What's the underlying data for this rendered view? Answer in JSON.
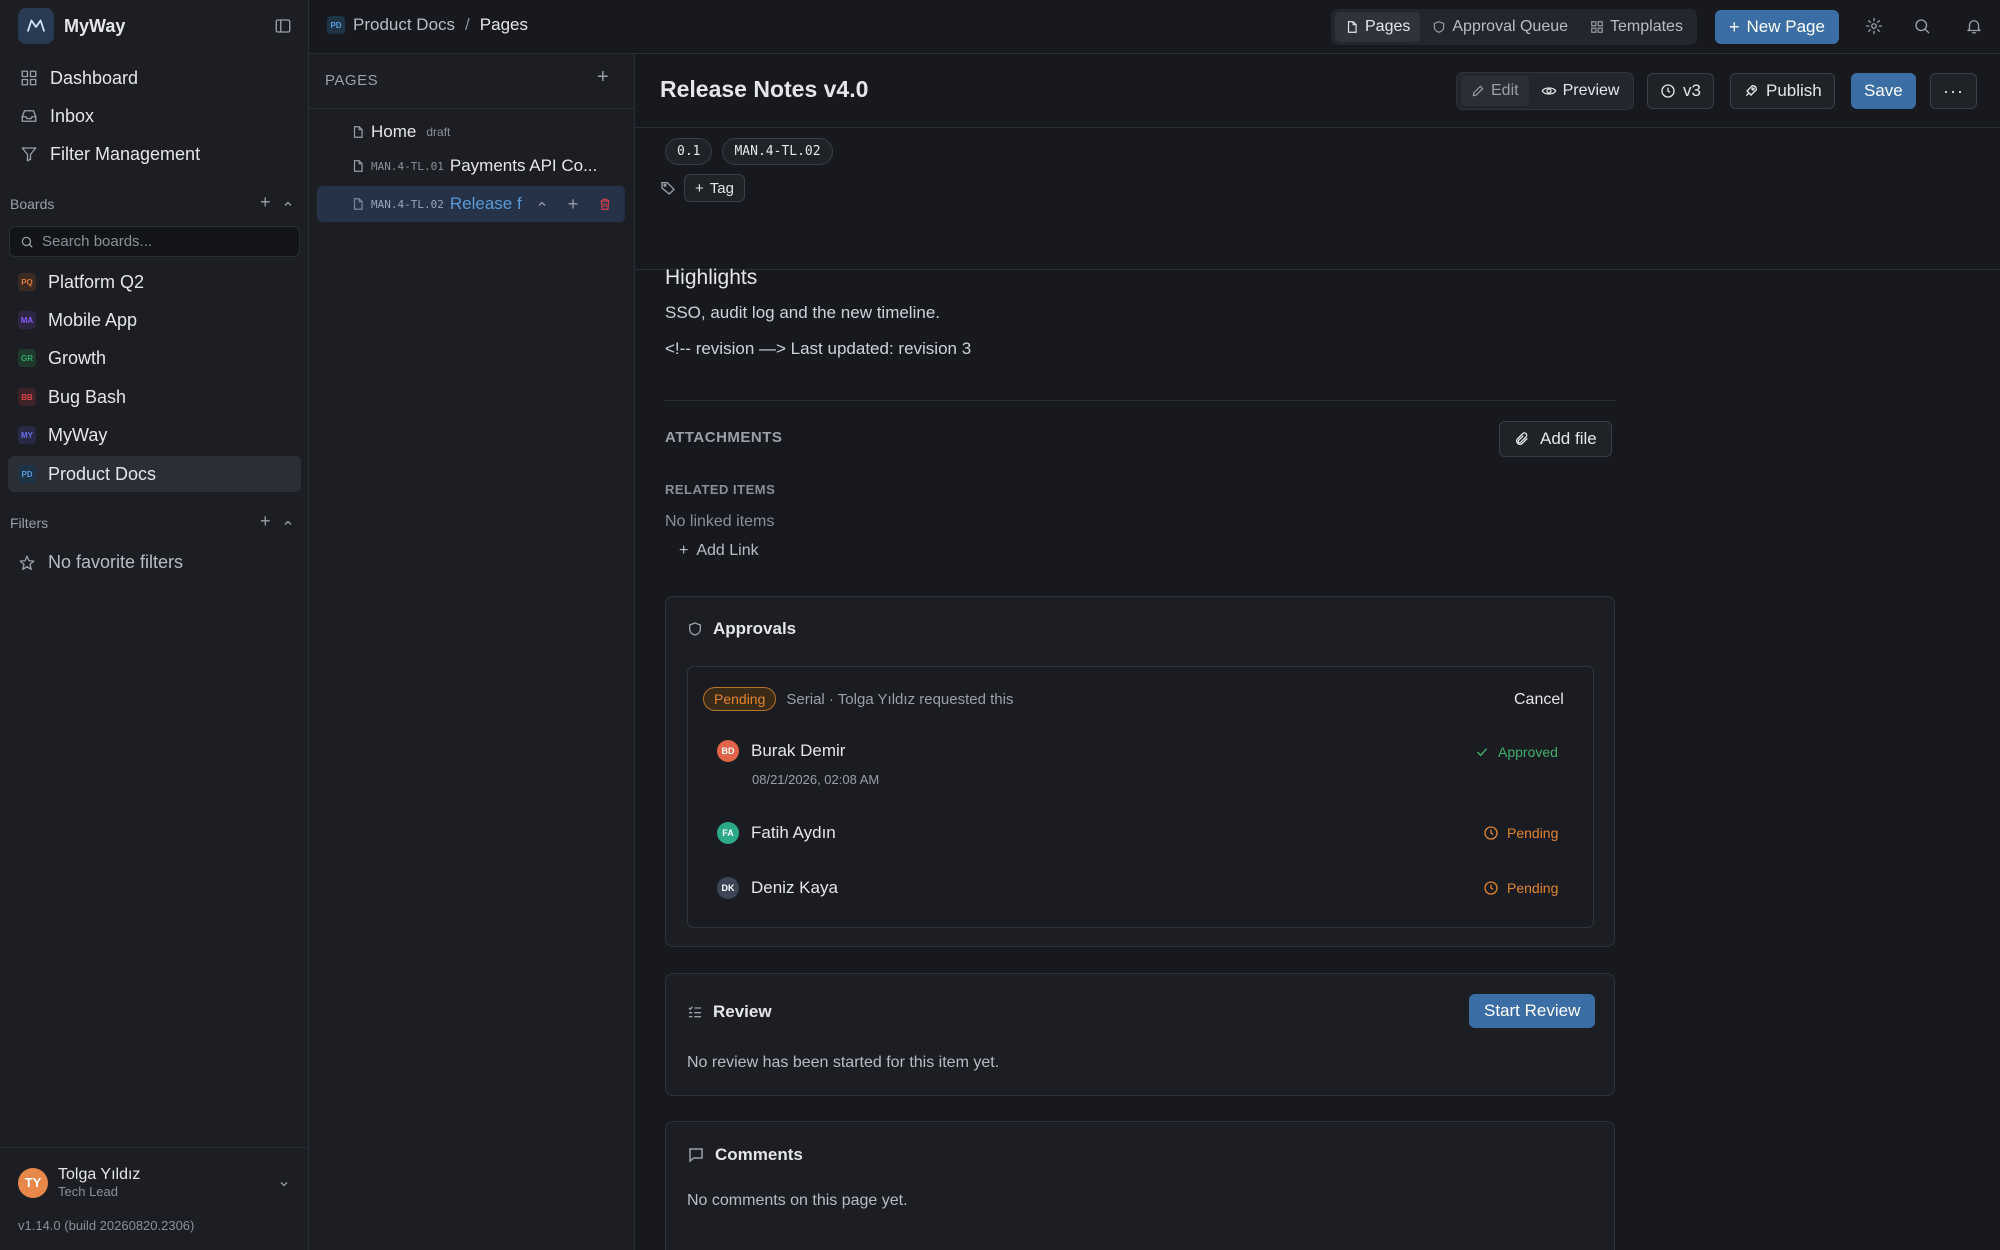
{
  "app": {
    "name": "MyWay",
    "version": "v1.14.0 (build 20260820.2306)"
  },
  "sidebar": {
    "nav": [
      {
        "label": "Dashboard",
        "icon": "grid-icon"
      },
      {
        "label": "Inbox",
        "icon": "inbox-icon"
      },
      {
        "label": "Filter Management",
        "icon": "filter-icon"
      }
    ],
    "boards_label": "Boards",
    "search_placeholder": "Search boards...",
    "boards": [
      {
        "abbr": "PQ",
        "label": "Platform Q2",
        "color": "#e07a3f"
      },
      {
        "abbr": "MA",
        "label": "Mobile App",
        "color": "#8a5cf6"
      },
      {
        "abbr": "GR",
        "label": "Growth",
        "color": "#2fa86b"
      },
      {
        "abbr": "BB",
        "label": "Bug Bash",
        "color": "#d9434f"
      },
      {
        "abbr": "MY",
        "label": "MyWay",
        "color": "#6a6ee8"
      },
      {
        "abbr": "PD",
        "label": "Product Docs",
        "color": "#3b82c4"
      }
    ],
    "filters_label": "Filters",
    "no_filters": "No favorite filters",
    "user": {
      "initials": "TY",
      "name": "Tolga Yıldız",
      "role": "Tech Lead"
    }
  },
  "topbar": {
    "breadcrumb": {
      "abbr": "PD",
      "project": "Product Docs",
      "sep": "/",
      "page": "Pages"
    },
    "tabs": [
      "Pages",
      "Approval Queue",
      "Templates"
    ],
    "new_page": "New Page"
  },
  "pages_panel": {
    "title": "PAGES",
    "items": [
      {
        "code": "",
        "label": "Home",
        "tag": "draft"
      },
      {
        "code": "MAN.4-TL.01",
        "label": "Payments API Co..."
      },
      {
        "code": "MAN.4-TL.02",
        "label": "Release f"
      }
    ]
  },
  "doc": {
    "title": "Release Notes v4.0",
    "actions": {
      "edit": "Edit",
      "preview": "Preview",
      "version": "v3",
      "publish": "Publish",
      "save": "Save"
    },
    "chips": [
      "0.1",
      "MAN.4-TL.02"
    ],
    "tag_button": "Tag",
    "heading": "Highlights",
    "para1": "SSO, audit log and the new timeline.",
    "para2": "<!-- revision —> Last updated: revision 3",
    "attachments_label": "ATTACHMENTS",
    "add_file": "Add file",
    "related_label": "RELATED ITEMS",
    "no_linked": "No linked items",
    "add_link": "Add Link"
  },
  "approvals": {
    "title": "Approvals",
    "status": "Pending",
    "meta": "Serial · Tolga Yıldız requested this",
    "cancel": "Cancel",
    "approvers": [
      {
        "initials": "BD",
        "name": "Burak Demir",
        "status": "Approved",
        "date": "08/21/2026, 02:08 AM",
        "color": "#e0634a",
        "status_color": "#3fae6a"
      },
      {
        "initials": "FA",
        "name": "Fatih Aydın",
        "status": "Pending",
        "date": "",
        "color": "#2aa888",
        "status_color": "#e0852f"
      },
      {
        "initials": "DK",
        "name": "Deniz Kaya",
        "status": "Pending",
        "date": "",
        "color": "#3c4656",
        "status_color": "#e0852f"
      }
    ]
  },
  "review": {
    "title": "Review",
    "start": "Start Review",
    "empty": "No review has been started for this item yet."
  },
  "comments": {
    "title": "Comments",
    "empty": "No comments on this page yet."
  }
}
